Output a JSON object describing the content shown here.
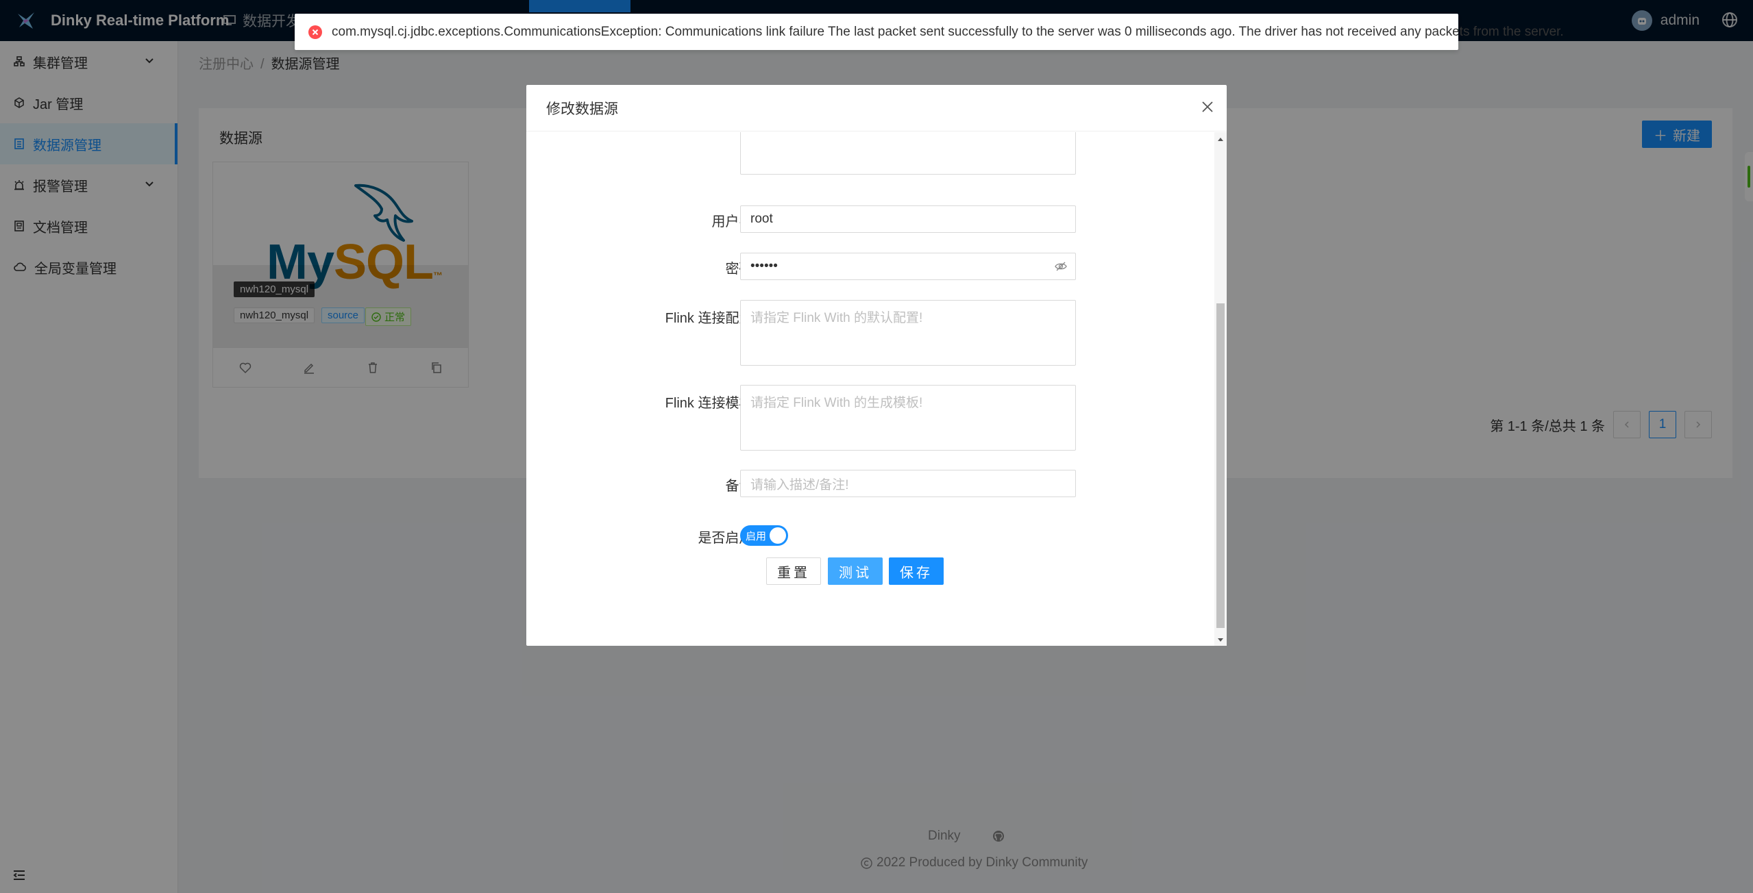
{
  "header": {
    "app_title": "Dinky Real-time Platform",
    "nav_partial": "数据开发",
    "user_name": "admin"
  },
  "sidebar": {
    "items": [
      {
        "label": "集群管理",
        "icon": "cluster-icon",
        "expandable": true
      },
      {
        "label": "Jar 管理",
        "icon": "jar-icon",
        "expandable": false
      },
      {
        "label": "数据源管理",
        "icon": "database-icon",
        "expandable": false,
        "active": true
      },
      {
        "label": "报警管理",
        "icon": "alarm-icon",
        "expandable": true
      },
      {
        "label": "文档管理",
        "icon": "document-icon",
        "expandable": false
      },
      {
        "label": "全局变量管理",
        "icon": "cloud-icon",
        "expandable": false
      }
    ]
  },
  "breadcrumb": {
    "parent": "注册中心",
    "separator": "/",
    "current": "数据源管理"
  },
  "content": {
    "title": "数据源",
    "new_button": "新建",
    "card": {
      "logo_my": "My",
      "logo_sql": "SQL",
      "logo_tm": "™",
      "tooltip": "nwh120_mysql",
      "name_tag": "nwh120_mysql",
      "type_tag": "source",
      "status_tag": "正常"
    },
    "pagination": {
      "summary": "第 1-1 条/总共 1 条",
      "current_page": "1"
    }
  },
  "footer": {
    "link": "Dinky",
    "copyright": "2022 Produced by Dinky Community"
  },
  "message": {
    "type": "error",
    "text": "com.mysql.cj.jdbc.exceptions.CommunicationsException: Communications link failure The last packet sent successfully to the server was 0 milliseconds ago. The driver has not received any packets from the server."
  },
  "modal": {
    "title": "修改数据源",
    "fields": {
      "username_label": "用户名:",
      "username_value": "root",
      "password_label": "密码:",
      "password_value": "••••••",
      "flink_config_label": "Flink 连接配置:",
      "flink_config_placeholder": "请指定 Flink With 的默认配置!",
      "flink_template_label": "Flink 连接模板:",
      "flink_template_placeholder": "请指定 Flink With 的生成模板!",
      "note_label": "备注:",
      "note_placeholder": "请输入描述/备注!",
      "enabled_label": "是否启用:",
      "enabled_switch": "启用"
    },
    "buttons": {
      "reset": "重置",
      "test": "测试",
      "save": "保存"
    }
  },
  "colors": {
    "primary": "#1890ff",
    "header_bg": "#001529",
    "error": "#ff4d4f",
    "success": "#52c41a"
  }
}
